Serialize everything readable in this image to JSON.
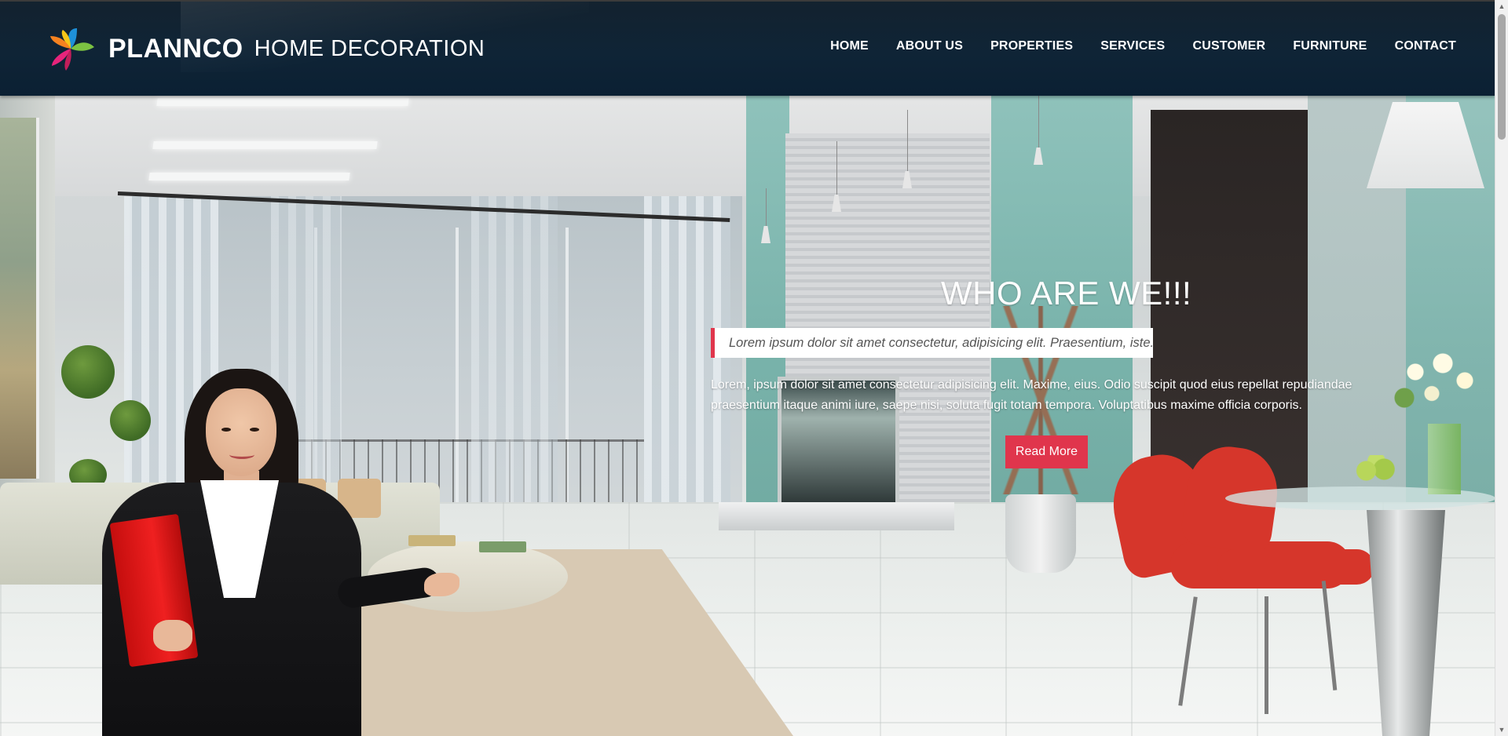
{
  "header": {
    "brand": "PLANNCO",
    "tagline": "HOME DECORATION",
    "nav": [
      {
        "label": "HOME"
      },
      {
        "label": "ABOUT US"
      },
      {
        "label": "PROPERTIES"
      },
      {
        "label": "SERVICES"
      },
      {
        "label": "CUSTOMER"
      },
      {
        "label": "FURNITURE"
      },
      {
        "label": "CONTACT"
      }
    ]
  },
  "hero": {
    "title": "WHO ARE WE!!!",
    "quote": "Lorem ipsum dolor sit amet consectetur, adipisicing elit. Praesentium, iste.",
    "text": "Lorem, ipsum dolor sit amet consectetur adipisicing elit. Maxime, eius. Odio suscipit quod eius repellat repudiandae praesentium itaque animi iure, saepe nisi, soluta fugit totam tempora. Voluptatibus maxime officia corporis.",
    "button": "Read More"
  },
  "colors": {
    "header_bg": "#0f2436",
    "accent": "#e0354c",
    "nav_text": "#ffffff"
  },
  "icons": {
    "logo": "pinwheel-logo-icon",
    "scroll_up": "scroll-up-arrow-icon",
    "scroll_down": "scroll-down-arrow-icon"
  }
}
